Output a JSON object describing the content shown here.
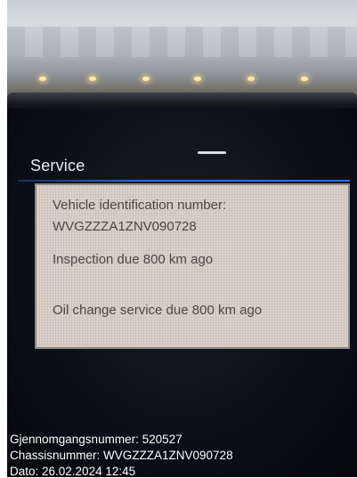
{
  "screen": {
    "title": "Service",
    "vin_label": "Vehicle identification number:",
    "vin_value": "WVGZZZA1ZNV090728",
    "inspection_text": "Inspection due 800 km ago",
    "oil_change_text": "Oil change service due 800 km ago"
  },
  "caption": {
    "line1": "Gjennomgangsnummer: 520527",
    "line2": "Chassisnummer: WVGZZZA1ZNV090728",
    "line3": "Dato: 26.02.2024 12:45"
  },
  "colors": {
    "accent": "#2f6df0",
    "panel_bg": "#dcd3cc",
    "panel_text": "#4d4743",
    "screen_bg": "#0c1018"
  }
}
